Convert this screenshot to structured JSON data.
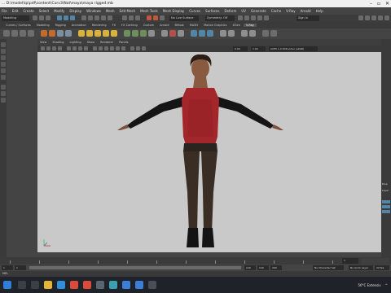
{
  "title_bar": {
    "text": "... D:\\model\\tp\\pdf\\content\\Curv3\\Nat\\maya\\maya rigged.mb"
  },
  "menu_bar": {
    "items": [
      "File",
      "Edit",
      "Create",
      "Select",
      "Modify",
      "Display",
      "Windows",
      "Mesh",
      "Edit Mesh",
      "Mesh Tools",
      "Mesh Display",
      "Curves",
      "Surfaces",
      "Deform",
      "UV",
      "Generate",
      "Cache",
      "V-Ray",
      "Arnold",
      "Help"
    ]
  },
  "status_line": {
    "mode": "Modeling",
    "no_live_surface": "No Live Surface",
    "symmetry": "Symmetry: Off",
    "sign_in": "Sign In"
  },
  "shelf_tabs": [
    "Curves / Surfaces",
    "Modeling",
    "Rigging",
    "Animation",
    "Rendering",
    "FX",
    "FX Caching",
    "Custom",
    "Arnold",
    "Bifrost",
    "MASH",
    "Motion Graphics",
    "XGen",
    "V-Ray"
  ],
  "shelf_tab_active": "V-Ray",
  "panel_menu": [
    "View",
    "Shading",
    "Lighting",
    "Show",
    "Renderer",
    "Panels"
  ],
  "panel_toolbar": {
    "value_a": "0.00",
    "value_b": "1.00",
    "color_space": "ACES 1.0 SDR-video (sRGB)"
  },
  "viewport": {
    "background": "#c9c9c9"
  },
  "right_panel": {
    "labels": [
      "Disp",
      "Layer"
    ]
  },
  "time_slider": {
    "start": "1",
    "end": "120"
  },
  "range_slider": {
    "start": "1",
    "inner_start": "1",
    "inner_end": "120",
    "end": "120",
    "range_value": "200",
    "character_set": "No Character Set",
    "anim_layer": "No Anim Layer",
    "fps": "24 fps"
  },
  "command_line": {
    "label": "MEL"
  },
  "taskbar": {
    "weather": "50°C  Extensiv",
    "icons": [
      "windows-logo",
      "search",
      "task-view",
      "file-explorer",
      "edge-browser",
      "chrome",
      "media-player",
      "steam",
      "maya",
      "store",
      "mail",
      "terminal"
    ]
  },
  "colors": {
    "accent": "#5285a6",
    "shelf_active": "#555555",
    "vest": "#a3262b",
    "sleeve": "#141414",
    "skin": "#8a5a40"
  }
}
